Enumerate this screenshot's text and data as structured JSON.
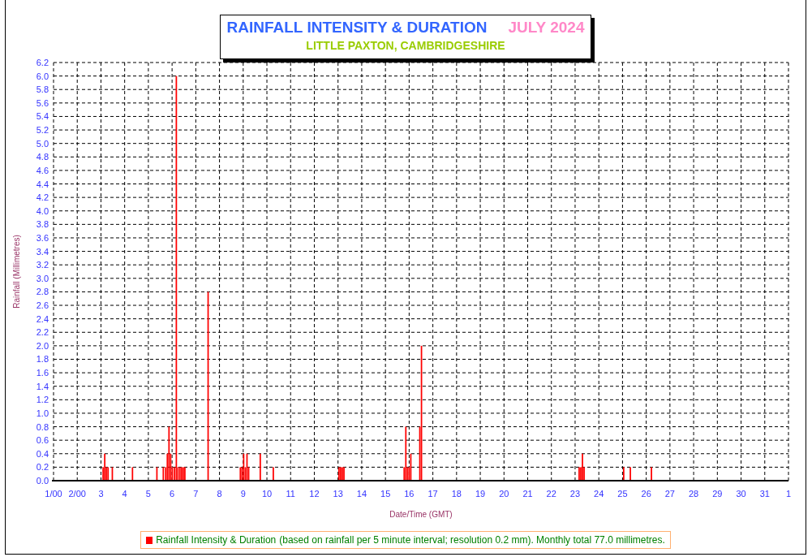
{
  "title_box": {
    "title": "RAINFALL INTENSITY & DURATION",
    "month": "JULY 2024",
    "location": "LITTLE PAXTON, CAMBRIDGESHIRE"
  },
  "chart": {
    "chart_data": {
      "type": "bar",
      "xlabel": "Date/Time (GMT)",
      "ylabel": "Rainfall (Millimetres)",
      "x": [
        3.09,
        3.16,
        3.23,
        3.3,
        3.48,
        4.33,
        5.36,
        5.63,
        5.73,
        5.8,
        5.87,
        5.94,
        6.01,
        6.1,
        6.18,
        6.25,
        6.33,
        6.4,
        6.47,
        6.54,
        7.52,
        8.88,
        8.95,
        9.02,
        9.09,
        9.16,
        9.23,
        9.72,
        10.27,
        13.04,
        13.11,
        13.18,
        13.25,
        15.79,
        15.86,
        15.93,
        16.0,
        16.07,
        16.45,
        16.52,
        23.17,
        23.24,
        23.31,
        23.38,
        25.05,
        25.33,
        26.22
      ],
      "series": [
        {
          "name": "Rainfall Intensity & Duration",
          "color": "#ff0000",
          "values": [
            0.2,
            0.4,
            0.2,
            0.2,
            0.2,
            0.2,
            0.2,
            0.2,
            0.2,
            0.4,
            0.8,
            0.4,
            0.2,
            0.2,
            6.0,
            0.2,
            0.2,
            0.2,
            0.2,
            0.2,
            2.8,
            0.2,
            0.2,
            0.4,
            0.2,
            0.4,
            0.2,
            0.4,
            0.2,
            0.2,
            0.2,
            0.2,
            0.2,
            0.2,
            0.8,
            0.2,
            0.2,
            0.4,
            0.8,
            2.0,
            0.2,
            0.2,
            0.4,
            0.2,
            0.2,
            0.2,
            0.2
          ]
        }
      ],
      "grid": true,
      "xlim": [
        1,
        32
      ],
      "ylim": [
        0,
        6.2
      ],
      "xticks": [
        {
          "value": 1,
          "label": "1/00"
        },
        {
          "value": 2,
          "label": "2/00"
        },
        3,
        4,
        5,
        6,
        7,
        8,
        9,
        10,
        11,
        12,
        13,
        14,
        15,
        16,
        17,
        18,
        19,
        20,
        21,
        22,
        23,
        24,
        25,
        26,
        27,
        28,
        29,
        30,
        31
      ],
      "yticks": [
        {
          "value": 0,
          "label": "0.0"
        },
        {
          "value": 0.2,
          "label": "0.2"
        },
        {
          "value": 0.4,
          "label": "0.4"
        },
        {
          "value": 0.6,
          "label": "0.6"
        },
        {
          "value": 0.8,
          "label": "0.8"
        },
        {
          "value": 1,
          "label": "1.0"
        },
        {
          "value": 1.2,
          "label": "1.2"
        },
        {
          "value": 1.4,
          "label": "1.4"
        },
        {
          "value": 1.6,
          "label": "1.6"
        },
        {
          "value": 1.8,
          "label": "1.8"
        },
        {
          "value": 2,
          "label": "2.0"
        },
        {
          "value": 2.2,
          "label": "2.2"
        },
        {
          "value": 2.4,
          "label": "2.4"
        },
        {
          "value": 2.6,
          "label": "2.6"
        },
        {
          "value": 2.8,
          "label": "2.8"
        },
        {
          "value": 3,
          "label": "3.0"
        },
        {
          "value": 3.2,
          "label": "3.2"
        },
        {
          "value": 3.4,
          "label": "3.4"
        },
        {
          "value": 3.6,
          "label": "3.6"
        },
        {
          "value": 3.8,
          "label": "3.8"
        },
        {
          "value": 4,
          "label": "4.0"
        },
        {
          "value": 4.2,
          "label": "4.2"
        },
        {
          "value": 4.4,
          "label": "4.4"
        },
        {
          "value": 4.6,
          "label": "4.6"
        },
        {
          "value": 4.8,
          "label": "4.8"
        },
        {
          "value": 5,
          "label": "5.0"
        },
        {
          "value": 5.2,
          "label": "5.2"
        },
        {
          "value": 5.4,
          "label": "5.4"
        },
        {
          "value": 5.6,
          "label": "5.6"
        },
        {
          "value": 5.8,
          "label": "5.8"
        },
        {
          "value": 6,
          "label": "6.0"
        },
        {
          "value": 6.2,
          "label": "6.2"
        }
      ]
    }
  },
  "axis_end_label": {
    "text": "1"
  },
  "legend": {
    "description": "(based on rainfall per 5 minute interval; resolution 0.2 mm). Monthly total 77.0 millimetres."
  }
}
